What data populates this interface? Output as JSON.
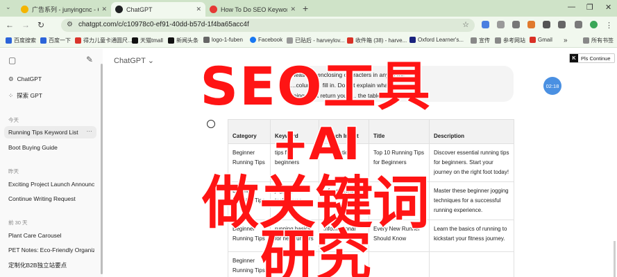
{
  "tabs": [
    {
      "title": "广告系列 - junyingcnc - Goo",
      "favicon_color": "#f4b400"
    },
    {
      "title": "ChatGPT",
      "favicon_color": "#202123"
    },
    {
      "title": "How To Do SEO Keyword Re",
      "favicon_color": "#e53935"
    }
  ],
  "address": {
    "url": "chatgpt.com/c/c10978c0-ef91-40dd-b57d-1f4ba65acc4f"
  },
  "bookmarks": [
    {
      "label": "百度搜索",
      "color": "#2b64d9"
    },
    {
      "label": "百度一下",
      "color": "#2b64d9"
    },
    {
      "label": "得力儿童卡通圆尺...",
      "color": "#d9342b"
    },
    {
      "label": "天猫tmall",
      "color": "#111111"
    },
    {
      "label": "新闻头条",
      "color": "#111111"
    },
    {
      "label": "logo-1-fuben",
      "color": "#666666"
    },
    {
      "label": "Facebook",
      "color": "#1877f2"
    },
    {
      "label": "已贴后 - harveylov...",
      "color": "#999999"
    },
    {
      "label": "收件箱 (38) - harve...",
      "color": "#d93025"
    },
    {
      "label": "Oxford Learner's...",
      "color": "#1a237e"
    },
    {
      "label": "宣传",
      "color": "#888888"
    },
    {
      "label": "参考网站",
      "color": "#888888"
    },
    {
      "label": "Gmail",
      "color": "#d93025"
    },
    {
      "label": "所有书签",
      "color": "#888888"
    }
  ],
  "sidebar": {
    "top_items": [
      {
        "label": "ChatGPT"
      },
      {
        "label": "探索 GPT"
      }
    ],
    "groups": [
      {
        "heading": "今天",
        "items": [
          "Running Tips Keyword List",
          "Boot Buying Guide"
        ]
      },
      {
        "heading": "昨天",
        "items": [
          "Exciting Project Launch Announc",
          "Continue Writing Request"
        ]
      },
      {
        "heading": "前 30 天",
        "items": [
          "Plant Care Carousel",
          "PET Notes: Eco-Friendly Organiz",
          "定制化B2B独立站要点"
        ]
      }
    ]
  },
  "header": {
    "model": "ChatGPT"
  },
  "extension": {
    "label": "Pls Continue"
  },
  "timer": {
    "value": "02:18"
  },
  "user_message": {
    "lines": [
      "Please … enclosing characters in any of the",
      "…column… fill in. Do not explain what you are",
      "doing. Just return your … the table."
    ]
  },
  "table": {
    "headers": [
      "Category",
      "Keyword",
      "Search Intent",
      "Title",
      "Description"
    ],
    "rows": [
      [
        "Beginner Running Tips",
        "tips for beginners",
        "Informational",
        "Top 10 Running Tips for Beginners",
        "Discover essential running tips for beginners. Start your journey on the right foot today!"
      ],
      [
        "Beginner Running Tips",
        "jogging techniques",
        "Informational",
        "",
        "Master these beginner jogging techniques for a successful running experience."
      ],
      [
        "Beginner Running Tips",
        "running basics for new runners",
        "Informational",
        "Every New Runner Should Know",
        "Learn the basics of running to kickstart your fitness journey."
      ],
      [
        "Beginner Running Tips",
        "",
        "",
        "",
        ""
      ]
    ]
  },
  "overlay": {
    "line1": "SEO工具",
    "line2": "+AI",
    "line3": "做关键词",
    "line4": "研究"
  }
}
